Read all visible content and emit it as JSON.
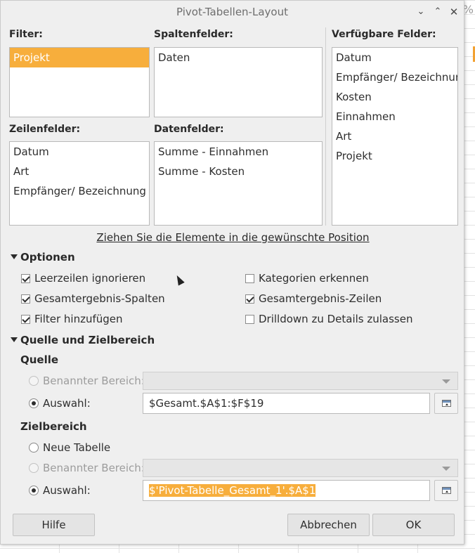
{
  "window": {
    "title": "Pivot-Tabellen-Layout"
  },
  "background_mark": "%",
  "filter": {
    "label": "Filter:",
    "items": [
      "Projekt"
    ],
    "selected_index": 0
  },
  "column_fields": {
    "label": "Spaltenfelder:",
    "items": [
      "Daten"
    ]
  },
  "available_fields": {
    "label": "Verfügbare Felder:",
    "items": [
      "Datum",
      "Empfänger/ Bezeichnung",
      "Kosten",
      "Einnahmen",
      "Art",
      "Projekt"
    ]
  },
  "row_fields": {
    "label": "Zeilenfelder:",
    "items": [
      "Datum",
      "Art",
      "Empfänger/ Bezeichnung"
    ]
  },
  "data_fields": {
    "label": "Datenfelder:",
    "items": [
      "Summe - Einnahmen",
      "Summe - Kosten"
    ]
  },
  "drag_hint": "Ziehen Sie die Elemente in die gewünschte Position",
  "options": {
    "title": "Optionen",
    "items": [
      {
        "label": "Leerzeilen ignorieren",
        "checked": true
      },
      {
        "label": "Kategorien erkennen",
        "checked": false
      },
      {
        "label": "Gesamtergebnis-Spalten",
        "checked": true
      },
      {
        "label": "Gesamtergebnis-Zeilen",
        "checked": true
      },
      {
        "label": "Filter hinzufügen",
        "checked": true
      },
      {
        "label": "Drilldown zu Details zulassen",
        "checked": false
      }
    ]
  },
  "source_dest": {
    "title": "Quelle und Zielbereich",
    "source": {
      "title": "Quelle",
      "named_range_label": "Benannter Bereich:",
      "selection_label": "Auswahl:",
      "selection_value": "$Gesamt.$A$1:$F$19"
    },
    "destination": {
      "title": "Zielbereich",
      "new_sheet_label": "Neue Tabelle",
      "named_range_label": "Benannter Bereich:",
      "selection_label": "Auswahl:",
      "selection_value": "$'Pivot-Tabelle_Gesamt_1'.$A$1"
    }
  },
  "buttons": {
    "help": "Hilfe",
    "cancel": "Abbrechen",
    "ok": "OK"
  },
  "colors": {
    "accent": "#f7ae3c",
    "dialog_bg": "#efefef"
  }
}
